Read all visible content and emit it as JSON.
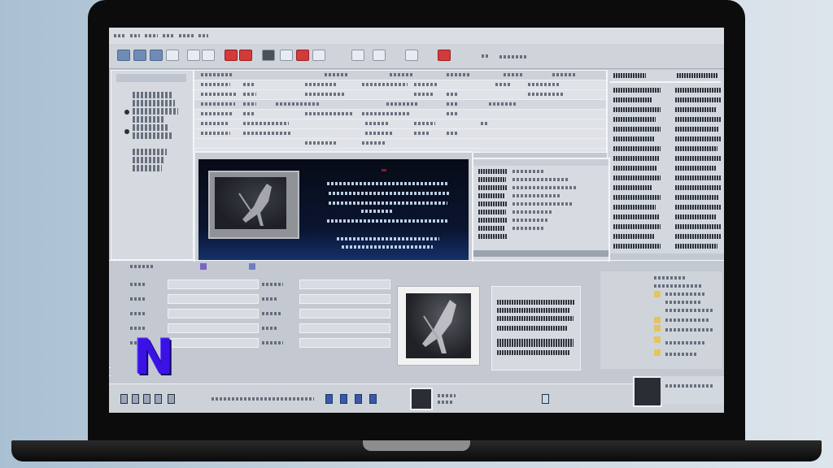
{
  "app": {
    "logo_letter": "N",
    "toolbar_icons": [
      "new-icon",
      "open-icon",
      "save-icon",
      "print-icon",
      "undo-icon",
      "redo-icon",
      "cut-icon",
      "copy-icon",
      "paste-icon",
      "pen-icon",
      "brush-icon",
      "red-tool-icon",
      "dropper-icon",
      "lock-icon",
      "camera-icon",
      "settings-icon"
    ]
  },
  "colors": {
    "logo": "#3b12e6",
    "video_bg": "#070b16",
    "subtitle": "#b9d8ff",
    "accent_red": "#d33a3a"
  },
  "transport": {
    "icons": [
      "rewind-icon",
      "pause-icon",
      "step-back-icon",
      "step-forward-icon",
      "loop-icon",
      "mark-in-icon",
      "mark-out-icon",
      "end-icon"
    ]
  }
}
